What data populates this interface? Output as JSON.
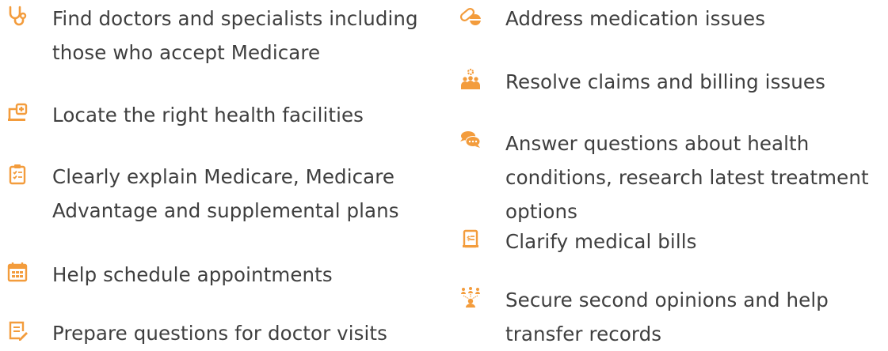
{
  "accent_color": "#f39c3c",
  "text_color": "#3f3f3f",
  "left_column": {
    "items": [
      {
        "icon": "stethoscope-icon",
        "label": "Find doctors and specialists including those who accept Medicare"
      },
      {
        "icon": "hospital-laptop-icon",
        "label": "Locate the right health facilities"
      },
      {
        "icon": "clipboard-checklist-icon",
        "label": "Clearly explain Medicare, Medicare Advantage and supplemental plans"
      },
      {
        "icon": "calendar-icon",
        "label": "Help schedule appointments"
      },
      {
        "icon": "notes-pen-icon",
        "label": "Prepare questions for doctor visits"
      }
    ]
  },
  "right_column": {
    "items": [
      {
        "icon": "pill-icon",
        "label": "Address medication issues"
      },
      {
        "icon": "team-gear-icon",
        "label": "Resolve claims and billing issues"
      },
      {
        "icon": "chat-bubbles-icon",
        "label": "Answer questions about health conditions, research latest treatment options"
      },
      {
        "icon": "bill-document-icon",
        "label": "Clarify medical bills"
      },
      {
        "icon": "people-network-icon",
        "label": "Secure second opinions and help transfer records"
      }
    ]
  }
}
